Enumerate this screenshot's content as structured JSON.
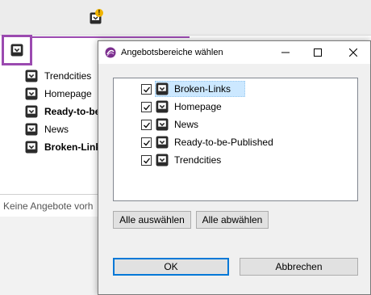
{
  "background_list": {
    "items": [
      {
        "label": "Trendcities",
        "bold": false
      },
      {
        "label": "Homepage",
        "bold": false
      },
      {
        "label": "Ready-to-be-",
        "bold": true
      },
      {
        "label": "News",
        "bold": false
      },
      {
        "label": "Broken-Links",
        "bold": true
      }
    ],
    "empty_text": "Keine Angebote vorh"
  },
  "notification": {
    "badge": "!"
  },
  "dialog": {
    "title": "Angebotsbereiche wählen",
    "items": [
      {
        "label": "Broken-Links",
        "checked": true,
        "selected": true
      },
      {
        "label": "Homepage",
        "checked": true,
        "selected": false
      },
      {
        "label": "News",
        "checked": true,
        "selected": false
      },
      {
        "label": "Ready-to-be-Published",
        "checked": true,
        "selected": false
      },
      {
        "label": "Trendcities",
        "checked": true,
        "selected": false
      }
    ],
    "select_all_label": "Alle auswählen",
    "deselect_all_label": "Alle abwählen",
    "ok_label": "OK",
    "cancel_label": "Abbrechen"
  },
  "colors": {
    "accent": "#9b4ab0",
    "selection": "#cce8ff",
    "default_button_border": "#0078d7"
  },
  "icons": [
    "offer-box-icon",
    "warning-badge-icon",
    "app-logo-icon",
    "minimize-icon",
    "maximize-icon",
    "close-icon",
    "checkbox-check-icon"
  ]
}
